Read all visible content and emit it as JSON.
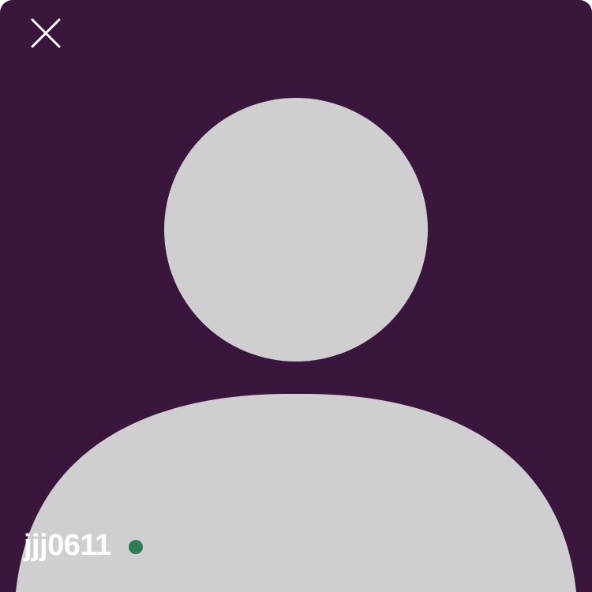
{
  "profile": {
    "username": "jjj0611",
    "status": "online"
  },
  "icons": {
    "close": "close-icon",
    "avatar": "default-user-avatar",
    "presence": "online-status-dot"
  },
  "colors": {
    "background": "#3a163d",
    "avatar_fill": "#d0ced1",
    "close_icon": "#ffffff",
    "username_text": "#ffffff",
    "presence_online": "#2e7d58"
  }
}
